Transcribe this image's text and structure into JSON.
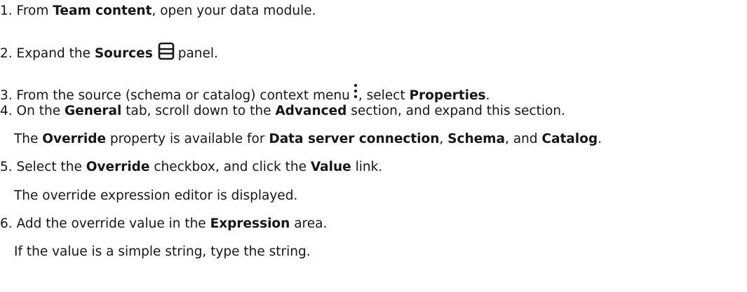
{
  "steps": [
    {
      "num": "1.",
      "parts": [
        "From ",
        "Team content",
        ", open your data module."
      ]
    },
    {
      "num": "2.",
      "parts": [
        "Expand the ",
        "Sources",
        "panel."
      ],
      "icon": "sources-panel-icon"
    },
    {
      "num": "3.",
      "parts": [
        "From the source (schema or catalog) context menu",
        ", select ",
        "Properties",
        "."
      ],
      "icon": "vertical-ellipsis-icon"
    },
    {
      "num": "4.",
      "parts": [
        "On the ",
        "General",
        " tab, scroll down to the ",
        "Advanced",
        " section, and expand this section."
      ],
      "note": [
        "The ",
        "Override",
        " property is available for ",
        "Data server connection",
        ", ",
        "Schema",
        ", and ",
        "Catalog",
        "."
      ]
    },
    {
      "num": "5.",
      "parts": [
        "Select the ",
        "Override",
        " checkbox, and click the ",
        "Value",
        " link."
      ],
      "note": [
        "The override expression editor is displayed."
      ]
    },
    {
      "num": "6.",
      "parts": [
        "Add the override value in the ",
        "Expression",
        " area."
      ],
      "note": [
        "If the value is a simple string, type the string."
      ]
    }
  ]
}
